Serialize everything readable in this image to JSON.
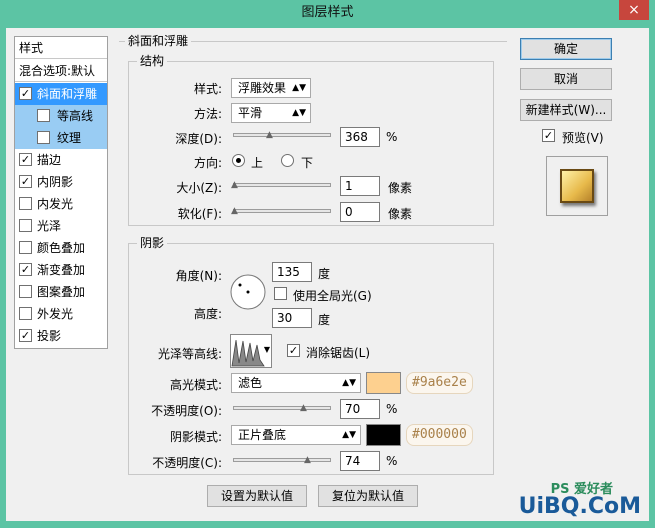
{
  "window": {
    "title": "图层样式",
    "close": "×"
  },
  "style_list": {
    "header": "样式",
    "blend": "混合选项:默认",
    "items": [
      {
        "label": "斜面和浮雕",
        "checked": true
      },
      {
        "label": "等高线",
        "checked": false
      },
      {
        "label": "纹理",
        "checked": false
      },
      {
        "label": "描边",
        "checked": true
      },
      {
        "label": "内阴影",
        "checked": true
      },
      {
        "label": "内发光",
        "checked": false
      },
      {
        "label": "光泽",
        "checked": false
      },
      {
        "label": "颜色叠加",
        "checked": false
      },
      {
        "label": "渐变叠加",
        "checked": true
      },
      {
        "label": "图案叠加",
        "checked": false
      },
      {
        "label": "外发光",
        "checked": false
      },
      {
        "label": "投影",
        "checked": true
      }
    ]
  },
  "bevel": {
    "title": "斜面和浮雕",
    "structure": {
      "title": "结构",
      "style_label": "样式:",
      "style_value": "浮雕效果",
      "technique_label": "方法:",
      "technique_value": "平滑",
      "depth_label": "深度(D):",
      "depth_value": "368",
      "depth_unit": "%",
      "direction_label": "方向:",
      "dir_up": "上",
      "dir_down": "下",
      "size_label": "大小(Z):",
      "size_value": "1",
      "size_unit": "像素",
      "soften_label": "软化(F):",
      "soften_value": "0",
      "soften_unit": "像素"
    },
    "shading": {
      "title": "阴影",
      "angle_label": "角度(N):",
      "angle_value": "135",
      "angle_unit": "度",
      "global_light": "使用全局光(G)",
      "altitude_label": "高度:",
      "altitude_value": "30",
      "altitude_unit": "度",
      "gloss_label": "光泽等高线:",
      "anti_alias": "消除锯齿(L)",
      "highlight_label": "高光模式:",
      "highlight_mode": "滤色",
      "highlight_color": "#fdd08f",
      "highlight_hex": "#9a6e2e",
      "hl_opacity_label": "不透明度(O):",
      "hl_opacity": "70",
      "pct": "%",
      "shadow_label": "阴影模式:",
      "shadow_mode": "正片叠底",
      "shadow_color": "#000000",
      "shadow_hex": "#000000",
      "sh_opacity_label": "不透明度(C):",
      "sh_opacity": "74"
    },
    "make_default": "设置为默认值",
    "reset_default": "复位为默认值"
  },
  "buttons": {
    "ok": "确定",
    "cancel": "取消",
    "new_style": "新建样式(W)...",
    "preview": "预览(V)"
  },
  "watermark": "UiBQ.CoM"
}
